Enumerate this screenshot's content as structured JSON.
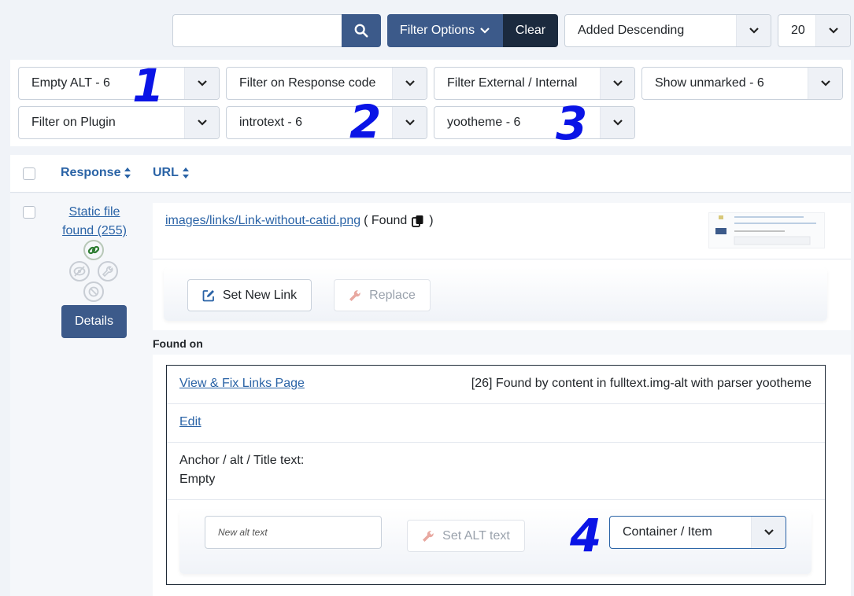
{
  "toolbar": {
    "search_value": "",
    "filter_options_label": "Filter Options",
    "clear_label": "Clear",
    "sort_value": "Added Descending",
    "limit_value": "20"
  },
  "filters": {
    "row1": [
      "Empty ALT - 6",
      "Filter on Response code",
      "Filter External / Internal",
      "Show unmarked - 6"
    ],
    "row2": [
      "Filter on Plugin",
      "introtext - 6",
      "yootheme - 6"
    ]
  },
  "annotations": [
    "1",
    "2",
    "3",
    "4"
  ],
  "table": {
    "col_response": "Response",
    "col_url": "URL"
  },
  "row": {
    "status_line1": "Static file",
    "status_line2": "found (255)",
    "details_label": "Details",
    "url": "images/links/Link-without-catid.png",
    "found_prefix": "( Found",
    "found_suffix": ")",
    "set_new_link_label": "Set New Link",
    "replace_label": "Replace"
  },
  "found_on": {
    "heading": "Found on",
    "view_fix_label": "View & Fix Links Page",
    "found_info": "[26] Found by content in fulltext.img-alt with parser yootheme",
    "edit_label": "Edit",
    "anchor_label": "Anchor / alt / Title text:",
    "anchor_value": "Empty",
    "alt_placeholder": "New alt text",
    "set_alt_label": "Set ALT text",
    "container_value": "Container / Item"
  },
  "colors": {
    "primary": "#3c5a8a",
    "dark": "#1b2a3e",
    "link": "#2a63a6",
    "annotation": "#0a14e6"
  }
}
